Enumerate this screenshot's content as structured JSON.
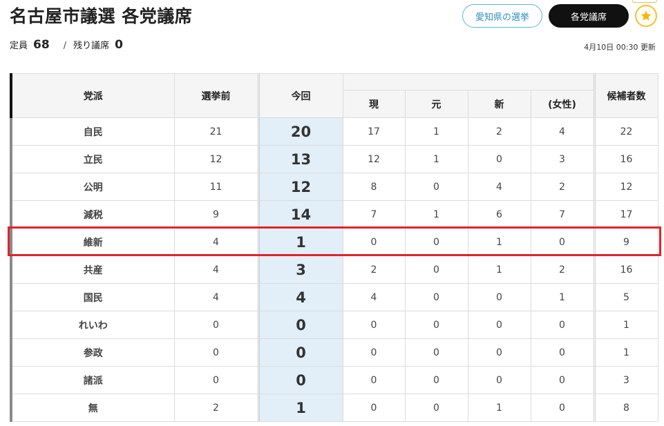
{
  "header": {
    "title": "名古屋市議選 各党議席",
    "pref_button": "愛知県の選挙",
    "party_button": "各党議席",
    "star_icon": "star-icon"
  },
  "summary": {
    "capacity_label": "定員",
    "capacity_value": "68",
    "remaining_label": "残り議席",
    "remaining_value": "0",
    "separator": "/",
    "updated": "4月10日 00:30 更新"
  },
  "table": {
    "headers": {
      "party": "党派",
      "before": "選挙前",
      "now": "今回",
      "incumbent": "現",
      "former": "元",
      "new": "新",
      "women": "(女性)",
      "candidates": "候補者数"
    },
    "rows": [
      {
        "party": "自民",
        "before": "21",
        "now": "20",
        "incumbent": "17",
        "former": "1",
        "new": "2",
        "women": "4",
        "candidates": "22"
      },
      {
        "party": "立民",
        "before": "12",
        "now": "13",
        "incumbent": "12",
        "former": "1",
        "new": "0",
        "women": "3",
        "candidates": "16"
      },
      {
        "party": "公明",
        "before": "11",
        "now": "12",
        "incumbent": "8",
        "former": "0",
        "new": "4",
        "women": "2",
        "candidates": "12"
      },
      {
        "party": "減税",
        "before": "9",
        "now": "14",
        "incumbent": "7",
        "former": "1",
        "new": "6",
        "women": "7",
        "candidates": "17"
      },
      {
        "party": "維新",
        "before": "4",
        "now": "1",
        "incumbent": "0",
        "former": "0",
        "new": "1",
        "women": "0",
        "candidates": "9"
      },
      {
        "party": "共産",
        "before": "4",
        "now": "3",
        "incumbent": "2",
        "former": "0",
        "new": "1",
        "women": "2",
        "candidates": "16"
      },
      {
        "party": "国民",
        "before": "4",
        "now": "4",
        "incumbent": "4",
        "former": "0",
        "new": "0",
        "women": "1",
        "candidates": "5"
      },
      {
        "party": "れいわ",
        "before": "0",
        "now": "0",
        "incumbent": "0",
        "former": "0",
        "new": "0",
        "women": "0",
        "candidates": "1"
      },
      {
        "party": "参政",
        "before": "0",
        "now": "0",
        "incumbent": "0",
        "former": "0",
        "new": "0",
        "women": "0",
        "candidates": "1"
      },
      {
        "party": "諸派",
        "before": "0",
        "now": "0",
        "incumbent": "0",
        "former": "0",
        "new": "0",
        "women": "0",
        "candidates": "3"
      },
      {
        "party": "無",
        "before": "2",
        "now": "1",
        "incumbent": "0",
        "former": "0",
        "new": "1",
        "women": "0",
        "candidates": "8"
      }
    ]
  },
  "colors": {
    "accent_blue": "#2f8fc0",
    "highlight_red": "#e0232b",
    "current_column_bg": "#e2eef8",
    "star_gold": "#f0b90b"
  }
}
